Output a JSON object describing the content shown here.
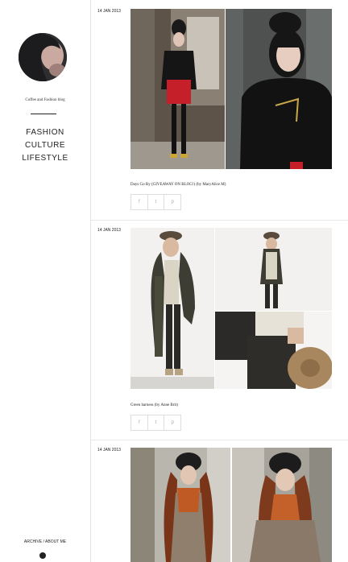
{
  "blog": {
    "tagline": "Coffee and Fashion blog",
    "nav": [
      "FASHION",
      "CULTURE",
      "LIFESTYLE"
    ],
    "footer": {
      "archive": "ARCHIVE",
      "separator": "/",
      "about": "ABOUT ME"
    }
  },
  "posts": [
    {
      "date": "14 JAN 2013",
      "caption": "Days Go By (GIVEAWAY ON BLOG!) (by MaryAlice M)"
    },
    {
      "date": "14 JAN 2013",
      "caption": "Green harness (by Anne Brit)"
    },
    {
      "date": "14 JAN 2013"
    }
  ],
  "share": {
    "facebook": "f",
    "twitter": "t",
    "pinterest": "p"
  },
  "icons": {
    "share": [
      "facebook-icon",
      "twitter-icon",
      "pinterest-icon"
    ],
    "footer": "pinterest-icon"
  }
}
